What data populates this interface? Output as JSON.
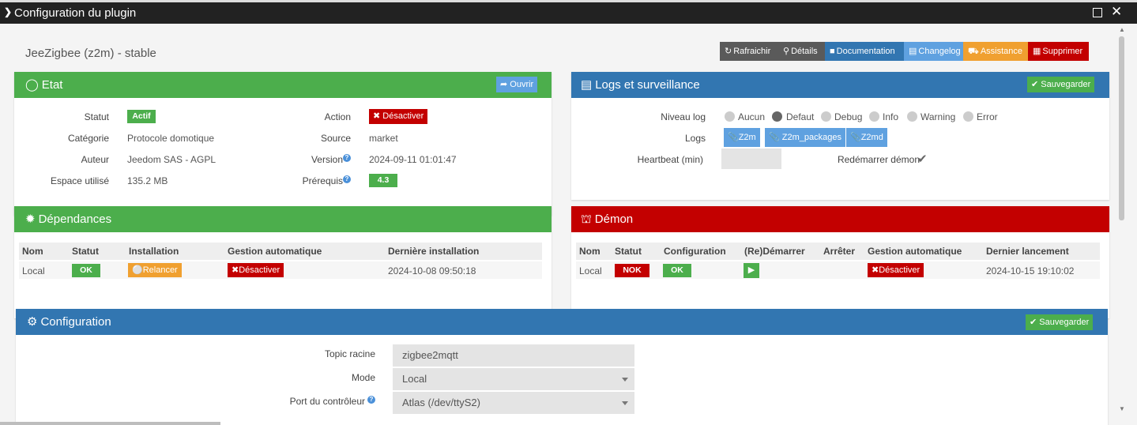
{
  "window": {
    "title": "Configuration du plugin"
  },
  "plugin": {
    "name": "JeeZigbee (z2m) - stable"
  },
  "toolbar": {
    "refresh": "Rafraichir",
    "details": "Détails",
    "documentation": "Documentation",
    "changelog": "Changelog",
    "assistance": "Assistance",
    "delete": "Supprimer"
  },
  "etat": {
    "title": "Etat",
    "open_btn": "Ouvrir",
    "statut_label": "Statut",
    "statut_value": "Actif",
    "categorie_label": "Catégorie",
    "categorie_value": "Protocole domotique",
    "auteur_label": "Auteur",
    "auteur_value": "Jeedom SAS - AGPL",
    "espace_label": "Espace utilisé",
    "espace_value": "135.2 MB",
    "action_label": "Action",
    "action_btn": "Désactiver",
    "source_label": "Source",
    "source_value": "market",
    "version_label": "Version",
    "version_value": "2024-09-11 01:01:47",
    "prerequis_label": "Prérequis",
    "prerequis_value": "4.3"
  },
  "logs": {
    "title": "Logs et surveillance",
    "save_btn": "Sauvegarder",
    "niveau_label": "Niveau log",
    "levels": [
      "Aucun",
      "Defaut",
      "Debug",
      "Info",
      "Warning",
      "Error"
    ],
    "selected_level": "Defaut",
    "logs_label": "Logs",
    "log_buttons": [
      "Z2m",
      "Z2m_packages",
      "Z2md"
    ],
    "heartbeat_label": "Heartbeat (min)",
    "heartbeat_value": "",
    "restart_label": "Redémarrer démon",
    "restart_checked": true
  },
  "dependances": {
    "title": "Dépendances",
    "columns": [
      "Nom",
      "Statut",
      "Installation",
      "Gestion automatique",
      "Dernière installation"
    ],
    "row": {
      "nom": "Local",
      "statut": "OK",
      "installation_btn": "Relancer",
      "gestion_btn": "Désactiver",
      "derniere": "2024-10-08 09:50:18"
    }
  },
  "demon": {
    "title": "Démon",
    "columns": [
      "Nom",
      "Statut",
      "Configuration",
      "(Re)Démarrer",
      "Arrêter",
      "Gestion automatique",
      "Dernier lancement"
    ],
    "row": {
      "nom": "Local",
      "statut": "NOK",
      "configuration": "OK",
      "gestion_btn": "Désactiver",
      "dernier": "2024-10-15 19:10:02"
    }
  },
  "configuration": {
    "title": "Configuration",
    "save_btn": "Sauvegarder",
    "topic_label": "Topic racine",
    "topic_value": "zigbee2mqtt",
    "mode_label": "Mode",
    "mode_value": "Local",
    "port_label": "Port du contrôleur",
    "port_value": "Atlas (/dev/ttyS2)"
  },
  "colors": {
    "green": "#4cae4c",
    "blue": "#3276b1",
    "red": "#c30000",
    "orange": "#f0a030",
    "light_blue": "#5fa1e0",
    "dark": "#555555"
  }
}
